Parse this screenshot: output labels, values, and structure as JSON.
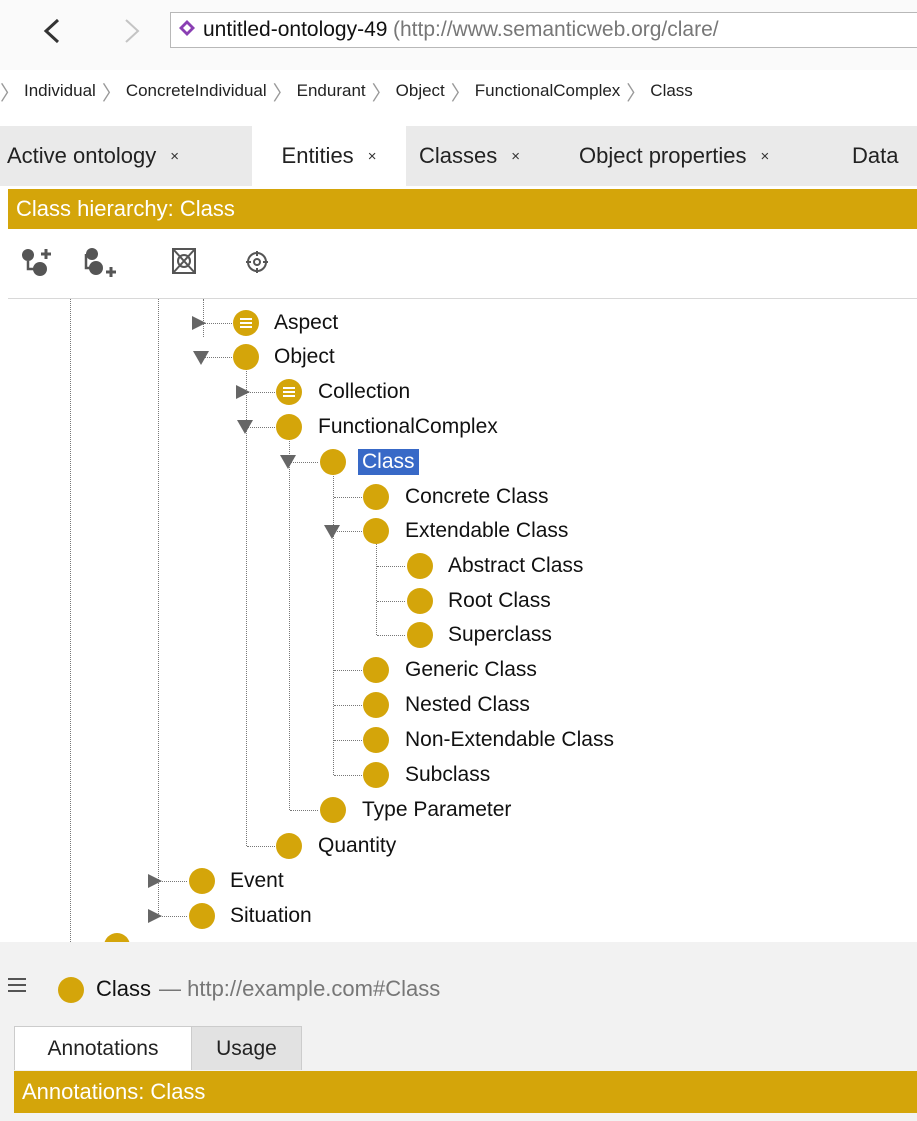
{
  "nav": {
    "back_glyph": "‹",
    "forward_glyph": "›",
    "ontology_name": "untitled-ontology-49",
    "ontology_iri": "(http://www.semanticweb.org/clare/",
    "breadcrumb": [
      "Individual",
      "ConcreteIndividual",
      "Endurant",
      "Object",
      "FunctionalComplex",
      "Class"
    ]
  },
  "tabs": [
    {
      "label": "Active ontology",
      "close": "×"
    },
    {
      "label": "Entities",
      "close": "×"
    },
    {
      "label": "Classes",
      "close": "×"
    },
    {
      "label": "Object properties",
      "close": "×"
    },
    {
      "label": "Data"
    }
  ],
  "hierarchy": {
    "header": "Class hierarchy: Class",
    "toolbar": [
      "add-subclass-icon",
      "add-sibling-icon",
      "delete-class-icon",
      "find-icon"
    ]
  },
  "tree": [
    {
      "label": "Aspect",
      "icon": "defined-class"
    },
    {
      "label": "Object",
      "icon": "class"
    },
    {
      "label": "Collection",
      "icon": "defined-class"
    },
    {
      "label": "FunctionalComplex",
      "icon": "class"
    },
    {
      "label": "Class",
      "icon": "class",
      "selected": true
    },
    {
      "label": "Concrete Class",
      "icon": "class"
    },
    {
      "label": "Extendable Class",
      "icon": "class"
    },
    {
      "label": "Abstract Class",
      "icon": "class"
    },
    {
      "label": "Root Class",
      "icon": "class"
    },
    {
      "label": "Superclass",
      "icon": "class"
    },
    {
      "label": "Generic Class",
      "icon": "class"
    },
    {
      "label": "Nested Class",
      "icon": "class"
    },
    {
      "label": "Non-Extendable Class",
      "icon": "class"
    },
    {
      "label": "Subclass",
      "icon": "class"
    },
    {
      "label": "Type Parameter",
      "icon": "class"
    },
    {
      "label": "Quantity",
      "icon": "class"
    },
    {
      "label": "Event",
      "icon": "class"
    },
    {
      "label": "Situation",
      "icon": "class"
    }
  ],
  "selected": {
    "name": "Class",
    "iri": "— http://example.com#Class"
  },
  "bottom_tabs": [
    "Annotations",
    "Usage"
  ],
  "annotations_header": "Annotations: Class",
  "colors": {
    "accent": "#d4a50a",
    "selection": "#3869c7"
  }
}
